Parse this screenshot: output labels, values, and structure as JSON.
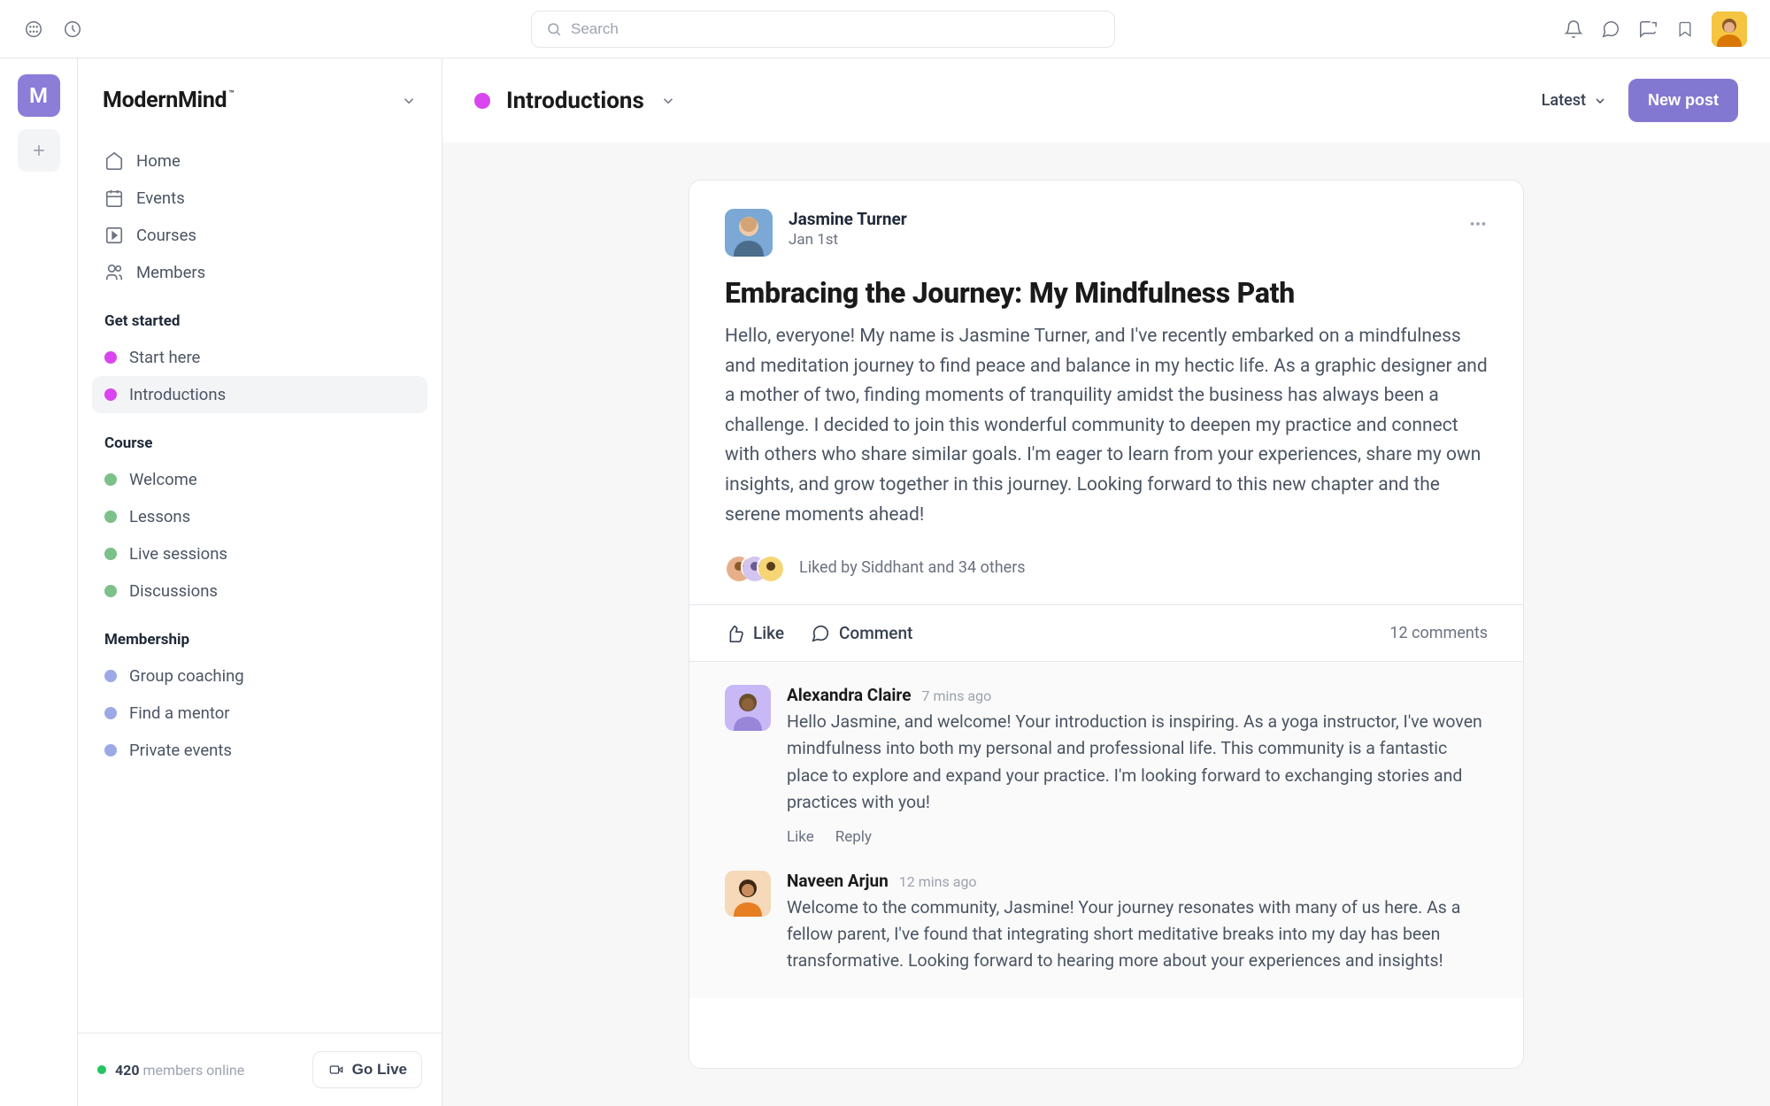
{
  "search": {
    "placeholder": "Search"
  },
  "community": {
    "name": "ModernMind",
    "trademark": "™",
    "letter": "M"
  },
  "nav": {
    "home": "Home",
    "events": "Events",
    "courses": "Courses",
    "members": "Members"
  },
  "sections": {
    "getStarted": {
      "label": "Get started",
      "items": {
        "0": "Start here",
        "1": "Introductions"
      }
    },
    "course": {
      "label": "Course",
      "items": {
        "0": "Welcome",
        "1": "Lessons",
        "2": "Live sessions",
        "3": "Discussions"
      }
    },
    "membership": {
      "label": "Membership",
      "items": {
        "0": "Group coaching",
        "1": "Find a mentor",
        "2": "Private events"
      }
    }
  },
  "footer": {
    "onlineCount": "420",
    "onlineLabel": "members online",
    "goLive": "Go Live"
  },
  "channel": {
    "title": "Introductions",
    "sort": "Latest",
    "newPost": "New post"
  },
  "post": {
    "author": "Jasmine Turner",
    "date": "Jan 1st",
    "title": "Embracing the Journey: My Mindfulness Path",
    "body": "Hello, everyone! My name is Jasmine Turner, and I've recently embarked on a mindfulness and meditation journey to find peace and balance in my hectic life. As a graphic designer and a mother of two, finding moments of tranquility amidst the business has always been a challenge. I decided to join this wonderful community to deepen my practice and connect with others who share similar goals. I'm eager to learn from your experiences, share my own insights, and grow together in this journey. Looking forward to this new chapter and the serene moments ahead!",
    "likesText": "Liked by Siddhant and 34 others",
    "like": "Like",
    "comment": "Comment",
    "commentCount": "12 comments",
    "actions": {
      "like": "Like",
      "reply": "Reply"
    },
    "comments": {
      "0": {
        "author": "Alexandra Claire",
        "time": "7 mins ago",
        "body": "Hello Jasmine, and welcome! Your introduction is inspiring. As a yoga instructor, I've woven mindfulness into both my personal and professional life. This community is a fantastic place to explore and expand your practice. I'm looking forward to exchanging stories and practices with you!"
      },
      "1": {
        "author": "Naveen Arjun",
        "time": "12 mins ago",
        "body": "Welcome to the community, Jasmine! Your journey resonates with many of us here. As a fellow parent, I've found that integrating short meditative breaks into my day has been transformative. Looking forward to hearing more about your experiences and insights!"
      }
    }
  }
}
